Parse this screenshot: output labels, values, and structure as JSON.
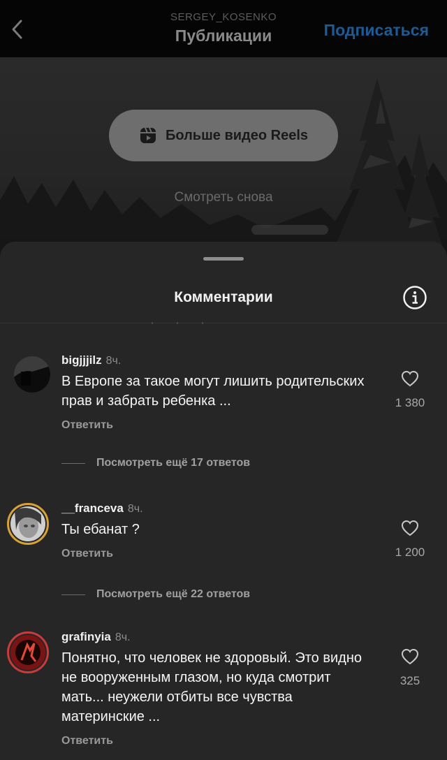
{
  "header": {
    "username": "SERGEY_KOSENKO",
    "title": "Публикации",
    "follow_label": "Подписаться"
  },
  "video": {
    "reels_button_label": "Больше видео Reels",
    "watch_again_label": "Смотреть снова"
  },
  "comments_sheet": {
    "title": "Комментарии",
    "comments": [
      {
        "username": "bigjjjilz",
        "time": "8ч.",
        "text": "В Европе за такое могут лишить родительских прав и забрать ребенка ...",
        "reply_label": "Ответить",
        "likes": "1 380",
        "more_replies": "Посмотреть ещё 17 ответов"
      },
      {
        "username": "__franceva",
        "time": "8ч.",
        "text": "Ты ебанат ?",
        "reply_label": "Ответить",
        "likes": "1 200",
        "more_replies": "Посмотреть ещё 22 ответов"
      },
      {
        "username": "grafinyia",
        "time": "8ч.",
        "text": "Понятно, что человек не здоровый. Это видно не вооруженным глазом, но куда смотрит мать... неужели отбиты все чувства материнские ...",
        "reply_label": "Ответить",
        "likes": "325"
      }
    ]
  },
  "colors": {
    "sheet_bg": "#262626",
    "follow_blue": "#1b5b96",
    "story_ring": "#d9a236"
  }
}
